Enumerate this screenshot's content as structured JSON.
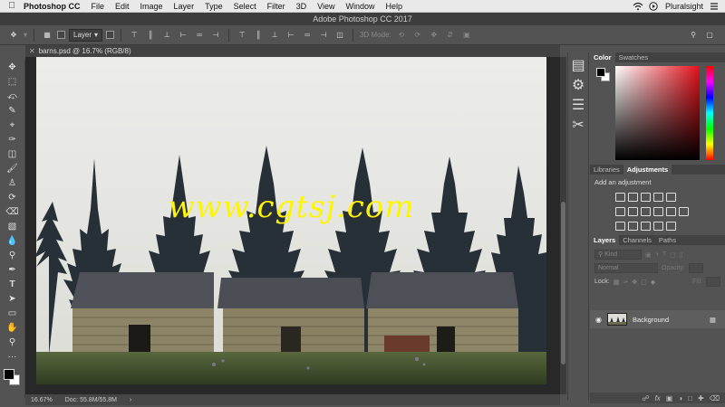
{
  "menubar": {
    "app_name": "Photoshop CC",
    "items": [
      "File",
      "Edit",
      "Image",
      "Layer",
      "Type",
      "Select",
      "Filter",
      "3D",
      "View",
      "Window",
      "Help"
    ],
    "account": "Pluralsight"
  },
  "window": {
    "title": "Adobe Photoshop CC 2017"
  },
  "options_bar": {
    "auto_select_target": "Layer",
    "mode_3d_label": "3D Mode:"
  },
  "document": {
    "tab_label": "barns.psd @ 16.7% (RGB/8)",
    "watermark": "www.cgtsj.com"
  },
  "status": {
    "zoom": "16.67%",
    "doc_size": "Doc: 55.8M/55.8M"
  },
  "color_panel": {
    "tabs": [
      "Color",
      "Swatches"
    ],
    "active_tab": "Color",
    "foreground": "#000000",
    "background": "#ffffff"
  },
  "adjustments_panel": {
    "tabs": [
      "Libraries",
      "Adjustments"
    ],
    "active_tab": "Adjustments",
    "title": "Add an adjustment"
  },
  "layers_panel": {
    "tabs": [
      "Layers",
      "Channels",
      "Paths"
    ],
    "active_tab": "Layers",
    "filter_placeholder": "Kind",
    "blend_mode": "Normal",
    "opacity_label": "Opacity:",
    "lock_label": "Lock:",
    "fill_label": "Fill:",
    "layers": [
      {
        "name": "Background",
        "visible": true,
        "locked": true
      }
    ]
  },
  "colors": {
    "accent": "#e3111b",
    "watermark": "#fff500"
  }
}
